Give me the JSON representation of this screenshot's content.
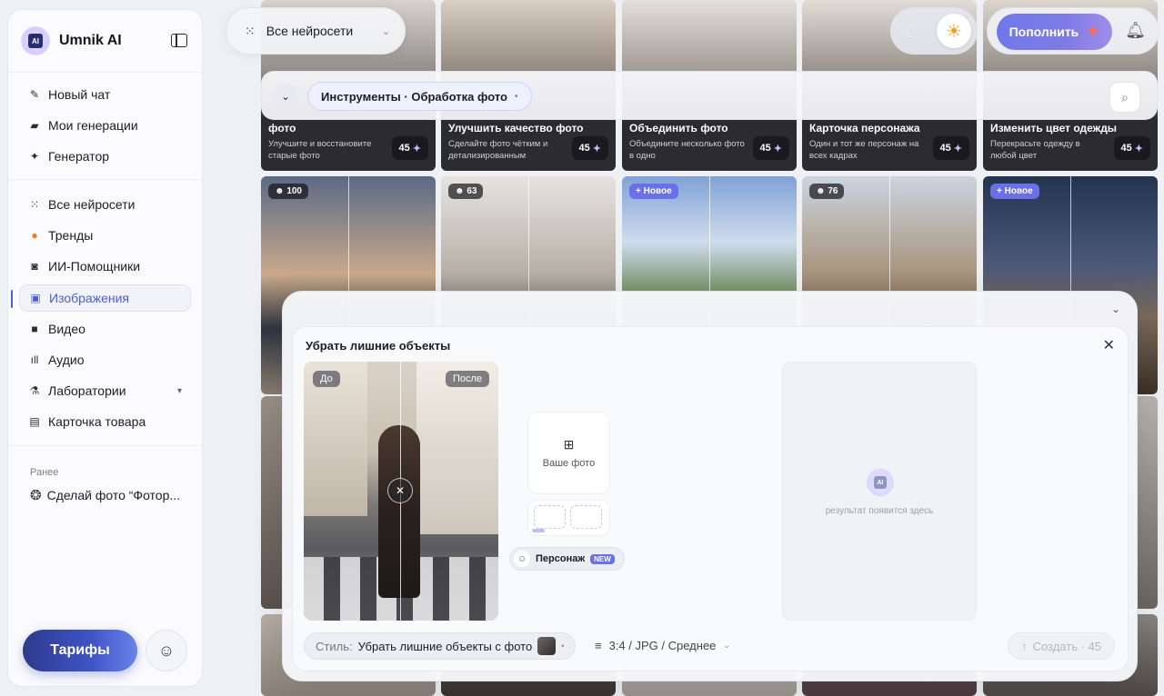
{
  "brand": {
    "name": "Umnik AI",
    "logo_text": "AI"
  },
  "sidebar": {
    "primary": [
      {
        "label": "Новый чат",
        "icon": "pen-icon"
      },
      {
        "label": "Мои генерации",
        "icon": "folder-icon"
      },
      {
        "label": "Генератор",
        "icon": "sparkle-icon"
      }
    ],
    "secondary": [
      {
        "label": "Все нейросети",
        "icon": "grid-icon"
      },
      {
        "label": "Тренды",
        "icon": "fire-icon"
      },
      {
        "label": "ИИ-Помощники",
        "icon": "robot-icon"
      },
      {
        "label": "Изображения",
        "icon": "image-icon",
        "active": true
      },
      {
        "label": "Видео",
        "icon": "video-icon"
      },
      {
        "label": "Аудио",
        "icon": "audio-wave-icon"
      },
      {
        "label": "Лаборатории",
        "icon": "flask-icon",
        "expandable": true
      },
      {
        "label": "Карточка товара",
        "icon": "card-icon"
      }
    ],
    "recent_label": "Ранее",
    "recent": [
      {
        "label": "Сделай фото “Фотор...",
        "icon": "openai-icon"
      }
    ],
    "tariffs_label": "Тарифы"
  },
  "topbar": {
    "model_select": "Все нейросети",
    "topup_label": "Пополнить"
  },
  "tools": {
    "chip_label": "Инструменты · Обработка фото"
  },
  "gallery": {
    "row1": [
      {
        "title": "фото",
        "desc": "Улучшите и восстановите старые фото",
        "price": "45"
      },
      {
        "title": "Улучшить качество фото",
        "desc": "Сделайте фото чётким и детализированным",
        "price": "45"
      },
      {
        "title": "Объединить фото",
        "desc": "Объедините несколько фото в одно",
        "price": "45"
      },
      {
        "title": "Карточка персонажа",
        "desc": "Один и тот же персонаж на всех кадрах",
        "price": "45"
      },
      {
        "title": "Изменить цвет одежды",
        "desc": "Перекрасьте одежду в любой цвет",
        "price": "45"
      }
    ],
    "row2": [
      {
        "badge": "100",
        "badge_type": "users"
      },
      {
        "badge": "63",
        "badge_type": "users"
      },
      {
        "badge": "Новое",
        "badge_type": "new"
      },
      {
        "badge": "76",
        "badge_type": "users"
      },
      {
        "badge": "Новое",
        "badge_type": "new"
      }
    ]
  },
  "modal": {
    "title": "Убрать лишние объекты",
    "before_label": "До",
    "after_label": "После",
    "upload_label": "Ваше фото",
    "persona_label": "Персонаж",
    "persona_badge": "NEW",
    "result_hint": "результат появится здесь",
    "result_logo_text": "AI",
    "style_prefix": "Стиль:",
    "style_value": "Убрать лишние объекты с фото",
    "params": "3:4 / JPG / Среднее",
    "create_label": "Создать · 45"
  }
}
